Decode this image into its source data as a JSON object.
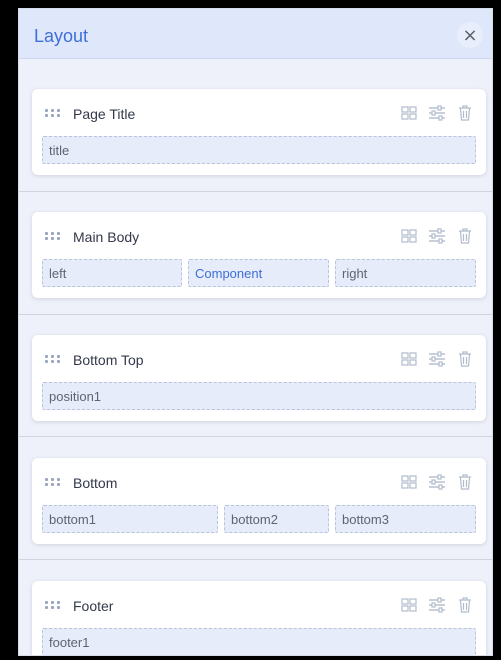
{
  "layout_panel": {
    "title": "Layout",
    "close_label": "×"
  },
  "rows": [
    {
      "title": "Page Title",
      "cells": [
        {
          "label": "title"
        }
      ]
    },
    {
      "title": "Main Body",
      "cells": [
        {
          "label": "left"
        },
        {
          "label": "Component",
          "accent": true
        },
        {
          "label": "right"
        }
      ]
    },
    {
      "title": "Bottom Top",
      "cells": [
        {
          "label": "position1"
        }
      ]
    },
    {
      "title": "Bottom",
      "cells": [
        {
          "label": "bottom1"
        },
        {
          "label": "bottom2"
        },
        {
          "label": "bottom3"
        }
      ]
    },
    {
      "title": "Footer",
      "cells": [
        {
          "label": "footer1"
        }
      ]
    }
  ],
  "icons": {
    "drag": "drag-handle-icon",
    "columns": "columns-grid-icon",
    "settings": "sliders-icon",
    "delete": "trash-icon"
  },
  "colors": {
    "accent": "#3f6fd8",
    "header_bg": "#dfe7fb",
    "cell_bg": "#e7ecfb"
  }
}
